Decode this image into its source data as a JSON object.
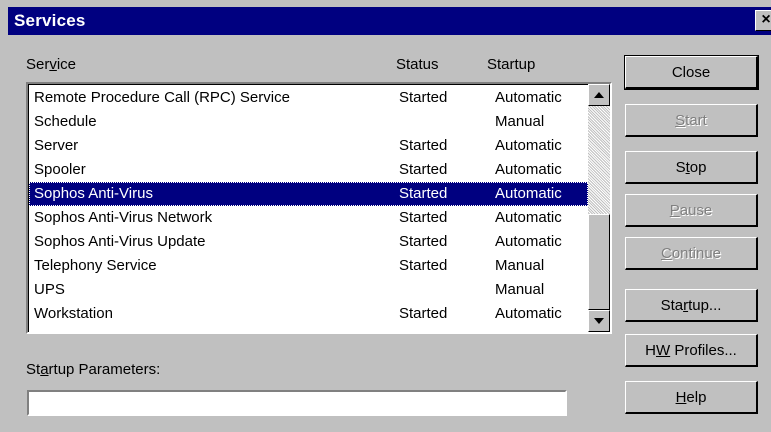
{
  "window": {
    "title": "Services",
    "close_glyph": "×"
  },
  "columns": {
    "service": "Service",
    "status": "Status",
    "startup": "Startup"
  },
  "services": [
    {
      "service": "Remote Procedure Call (RPC) Service",
      "status": "Started",
      "startup": "Automatic"
    },
    {
      "service": "Schedule",
      "status": "",
      "startup": "Manual"
    },
    {
      "service": "Server",
      "status": "Started",
      "startup": "Automatic"
    },
    {
      "service": "Spooler",
      "status": "Started",
      "startup": "Automatic"
    },
    {
      "service": "Sophos Anti-Virus",
      "status": "Started",
      "startup": "Automatic",
      "selected": true
    },
    {
      "service": "Sophos Anti-Virus Network",
      "status": "Started",
      "startup": "Automatic"
    },
    {
      "service": "Sophos Anti-Virus Update",
      "status": "Started",
      "startup": "Automatic"
    },
    {
      "service": "Telephony Service",
      "status": "Started",
      "startup": "Manual"
    },
    {
      "service": "UPS",
      "status": "",
      "startup": "Manual"
    },
    {
      "service": "Workstation",
      "status": "Started",
      "startup": "Automatic"
    }
  ],
  "startup_parameters": {
    "label": "Startup Parameters:",
    "value": ""
  },
  "buttons": {
    "close": "Close",
    "start": "Start",
    "stop": "Stop",
    "pause": "Pause",
    "continue": "Continue",
    "startup": "Startup...",
    "hw_profiles": "HW Profiles...",
    "help": "Help"
  },
  "icons": {
    "scroll_up": "up-arrow-icon",
    "scroll_down": "down-arrow-icon"
  },
  "colors": {
    "titlebar": "#000080",
    "selection": "#000080",
    "face": "#c0c0c0"
  }
}
